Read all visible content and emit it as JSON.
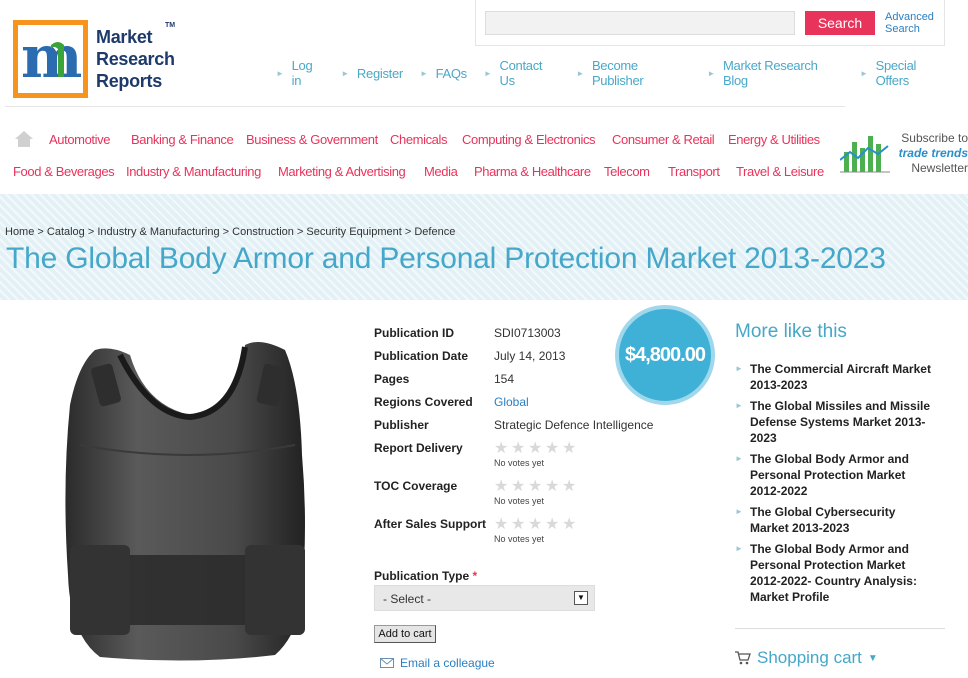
{
  "logo": {
    "lines": [
      "Market",
      "Research",
      "Reports"
    ],
    "tm": "TM"
  },
  "search": {
    "placeholder": "",
    "button": "Search",
    "advanced": "Advanced Search"
  },
  "top_links": [
    "Log in",
    "Register",
    "FAQs",
    "Contact Us",
    "Become Publisher",
    "Market Research Blog",
    "Special Offers"
  ],
  "categories_row1": [
    "Automotive",
    "Banking & Finance",
    "Business & Government",
    "Chemicals",
    "Computing & Electronics",
    "Consumer & Retail",
    "Energy & Utilities"
  ],
  "categories_row2": [
    "Food & Beverages",
    "Industry & Manufacturing",
    "Marketing & Advertising",
    "Media",
    "Pharma & Healthcare",
    "Telecom",
    "Transport",
    "Travel & Leisure"
  ],
  "newsletter": {
    "line1": "Subscribe to",
    "line2": "trade trends",
    "line3": "Newsletter"
  },
  "breadcrumb": "Home > Catalog > Industry & Manufacturing > Construction > Security Equipment > Defence",
  "title": "The Global Body Armor and Personal Protection Market 2013-2023",
  "price": "$4,800.00",
  "details": {
    "publication_id_label": "Publication ID",
    "publication_id": "SDI0713003",
    "date_label": "Publication Date",
    "date": "July 14, 2013",
    "pages_label": "Pages",
    "pages": "154",
    "regions_label": "Regions Covered",
    "regions": "Global",
    "publisher_label": "Publisher",
    "publisher": "Strategic Defence Intelligence",
    "delivery_label": "Report Delivery",
    "toc_label": "TOC Coverage",
    "support_label": "After Sales Support",
    "no_votes": "No votes yet",
    "rating_stars": 5,
    "rating_value": 0
  },
  "publication_type": {
    "label": "Publication Type",
    "required": "*",
    "selected": "- Select -"
  },
  "add_to_cart": "Add to cart",
  "email_colleague": "Email a colleague",
  "more_like_this": {
    "title": "More like this",
    "items": [
      "The Commercial Aircraft Market 2013-2023",
      "The Global Missiles and Missile Defense Systems Market 2013-2023",
      "The Global Body Armor and Personal Protection Market 2012-2022",
      "The Global Cybersecurity Market 2013-2023",
      "The Global Body Armor and Personal Protection Market 2012-2022- Country Analysis: Market Profile"
    ]
  },
  "shopping_cart": "Shopping cart",
  "colors": {
    "accent": "#e8335a",
    "heading": "#45a7c9",
    "link": "#2a7fc0",
    "price_bg": "#3fb0d6"
  }
}
